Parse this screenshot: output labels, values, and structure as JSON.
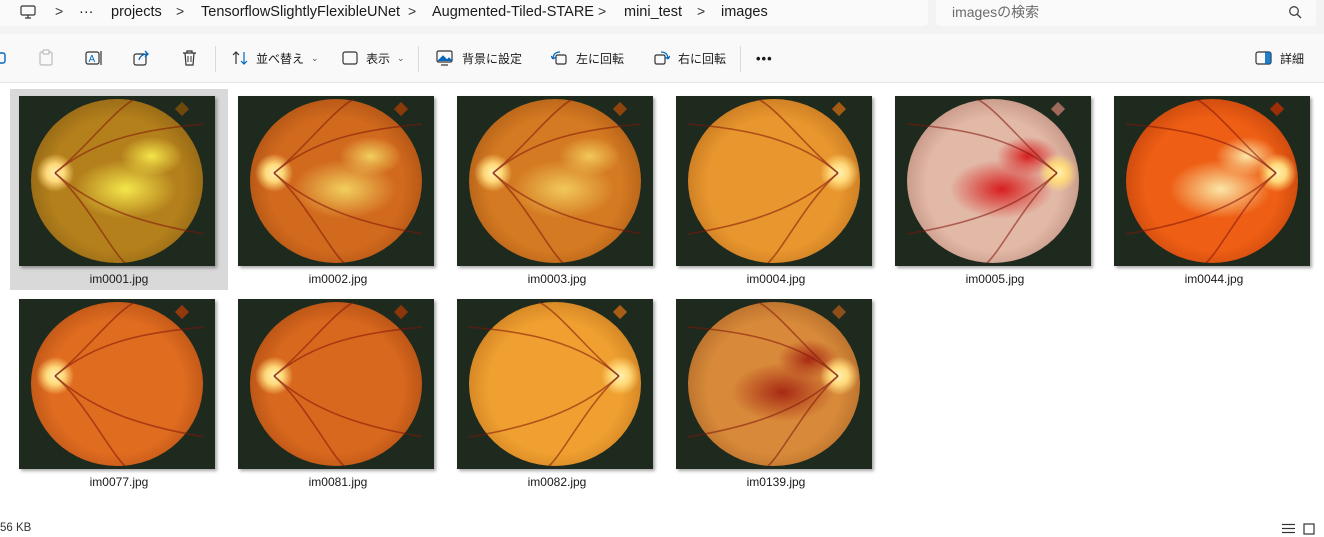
{
  "breadcrumb": {
    "items": [
      "projects",
      "TensorflowSlightlyFlexibleUNet",
      "Augmented-Tiled-STARE",
      "mini_test",
      "images"
    ]
  },
  "search": {
    "placeholder": "imagesの検索"
  },
  "toolbar": {
    "sort_label": "並べ替え",
    "view_label": "表示",
    "set_background_label": "背景に設定",
    "rotate_left_label": "左に回転",
    "rotate_right_label": "右に回転",
    "more_label": "•••",
    "details_label": "詳細"
  },
  "files": [
    {
      "name": "im0001.jpg",
      "selected": true,
      "image": {
        "base": "#b4801c",
        "edge": "#6d4a0c",
        "disc": "left",
        "exudate": "#f4e64a"
      }
    },
    {
      "name": "im0002.jpg",
      "selected": false,
      "image": {
        "base": "#d26a1e",
        "edge": "#8a3a0a",
        "disc": "left",
        "exudate": "#f1cf5e"
      }
    },
    {
      "name": "im0003.jpg",
      "selected": false,
      "image": {
        "base": "#d47a22",
        "edge": "#8e440c",
        "disc": "left",
        "exudate": "#f2c85a"
      }
    },
    {
      "name": "im0004.jpg",
      "selected": false,
      "image": {
        "base": "#e8962e",
        "edge": "#a35a12",
        "disc": "right",
        "exudate": ""
      }
    },
    {
      "name": "im0005.jpg",
      "selected": false,
      "image": {
        "base": "#e2b8a6",
        "edge": "#9f6a5c",
        "disc": "right",
        "exudate": "#d81e1e"
      }
    },
    {
      "name": "im0044.jpg",
      "selected": false,
      "image": {
        "base": "#ee5e14",
        "edge": "#9e2e06",
        "disc": "right",
        "exudate": "#fbe6a6"
      }
    },
    {
      "name": "im0077.jpg",
      "selected": false,
      "image": {
        "base": "#e06c20",
        "edge": "#923a0c",
        "disc": "left",
        "exudate": ""
      }
    },
    {
      "name": "im0081.jpg",
      "selected": false,
      "image": {
        "base": "#d8681e",
        "edge": "#8c360a",
        "disc": "left",
        "exudate": ""
      }
    },
    {
      "name": "im0082.jpg",
      "selected": false,
      "image": {
        "base": "#f0a030",
        "edge": "#a85e14",
        "disc": "right",
        "exudate": ""
      }
    },
    {
      "name": "im0139.jpg",
      "selected": false,
      "image": {
        "base": "#d88a3a",
        "edge": "#8e4e18",
        "disc": "right",
        "exudate": "#a82a14"
      }
    }
  ],
  "status": {
    "size_text": "56 KB"
  },
  "colors": {
    "window_bg": "#ffffff",
    "selection": "#d9d9d9",
    "accent": "#0067c0"
  }
}
